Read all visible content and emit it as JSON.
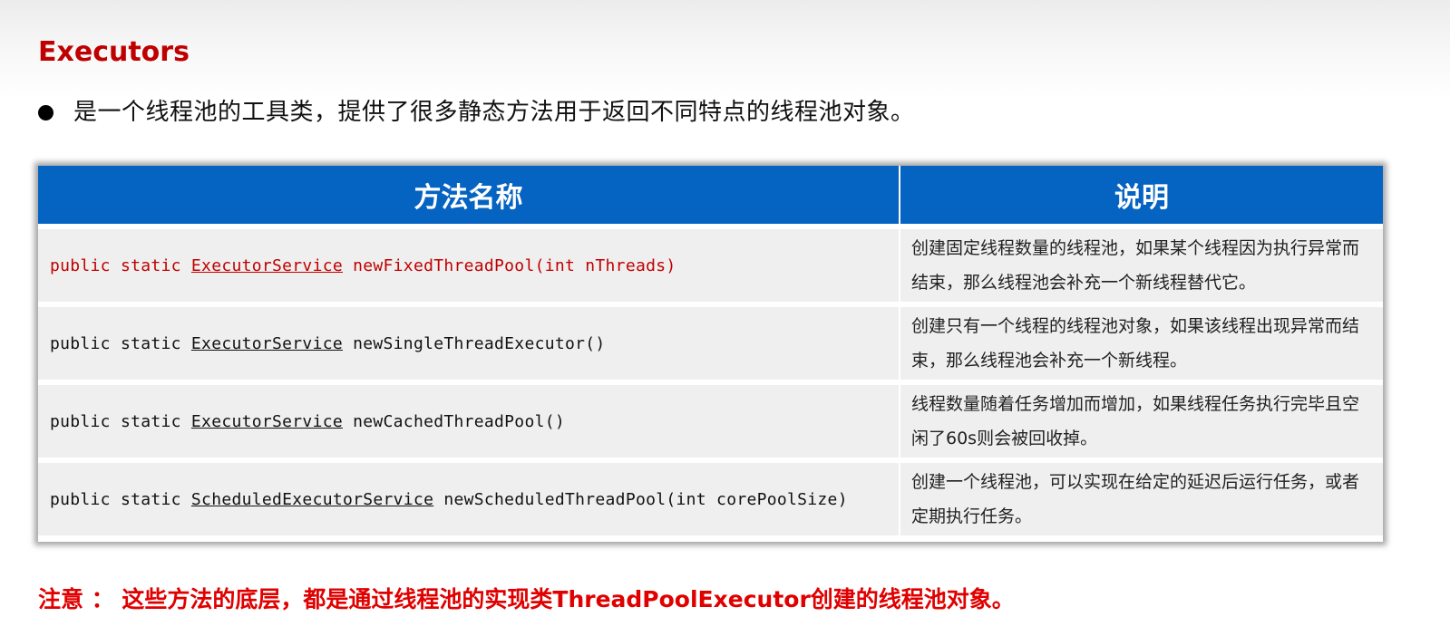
{
  "title": "Executors",
  "bullet": "是一个线程池的工具类，提供了很多静态方法用于返回不同特点的线程池对象。",
  "table": {
    "headers": [
      "方法名称",
      "说明"
    ],
    "rows": [
      {
        "prefix": "public static ",
        "type": "ExecutorService",
        "method": " newFixedThreadPool(int nThreads)",
        "highlight": true,
        "description": "创建固定线程数量的线程池，如果某个线程因为执行异常而结束，那么线程池会补充一个新线程替代它。"
      },
      {
        "prefix": "public static ",
        "type": "ExecutorService",
        "method": " newSingleThreadExecutor()",
        "highlight": false,
        "description": "创建只有一个线程的线程池对象，如果该线程出现异常而结束，那么线程池会补充一个新线程。"
      },
      {
        "prefix": "public static ",
        "type": "ExecutorService",
        "method": " newCachedThreadPool()",
        "highlight": false,
        "description": "线程数量随着任务增加而增加，如果线程任务执行完毕且空闲了60s则会被回收掉。"
      },
      {
        "prefix": "public static ",
        "type": "ScheduledExecutorService",
        "method": " newScheduledThreadPool(int corePoolSize)",
        "highlight": false,
        "description": "创建一个线程池，可以实现在给定的延迟后运行任务，或者定期执行任务。"
      }
    ]
  },
  "note": "注意 ： 这些方法的底层，都是通过线程池的实现类ThreadPoolExecutor创建的线程池对象。",
  "colors": {
    "title": "#c00000",
    "header_bg": "#0563c1",
    "row_bg": "#efefef",
    "highlight_code": "#c00000",
    "note": "#e00000"
  }
}
